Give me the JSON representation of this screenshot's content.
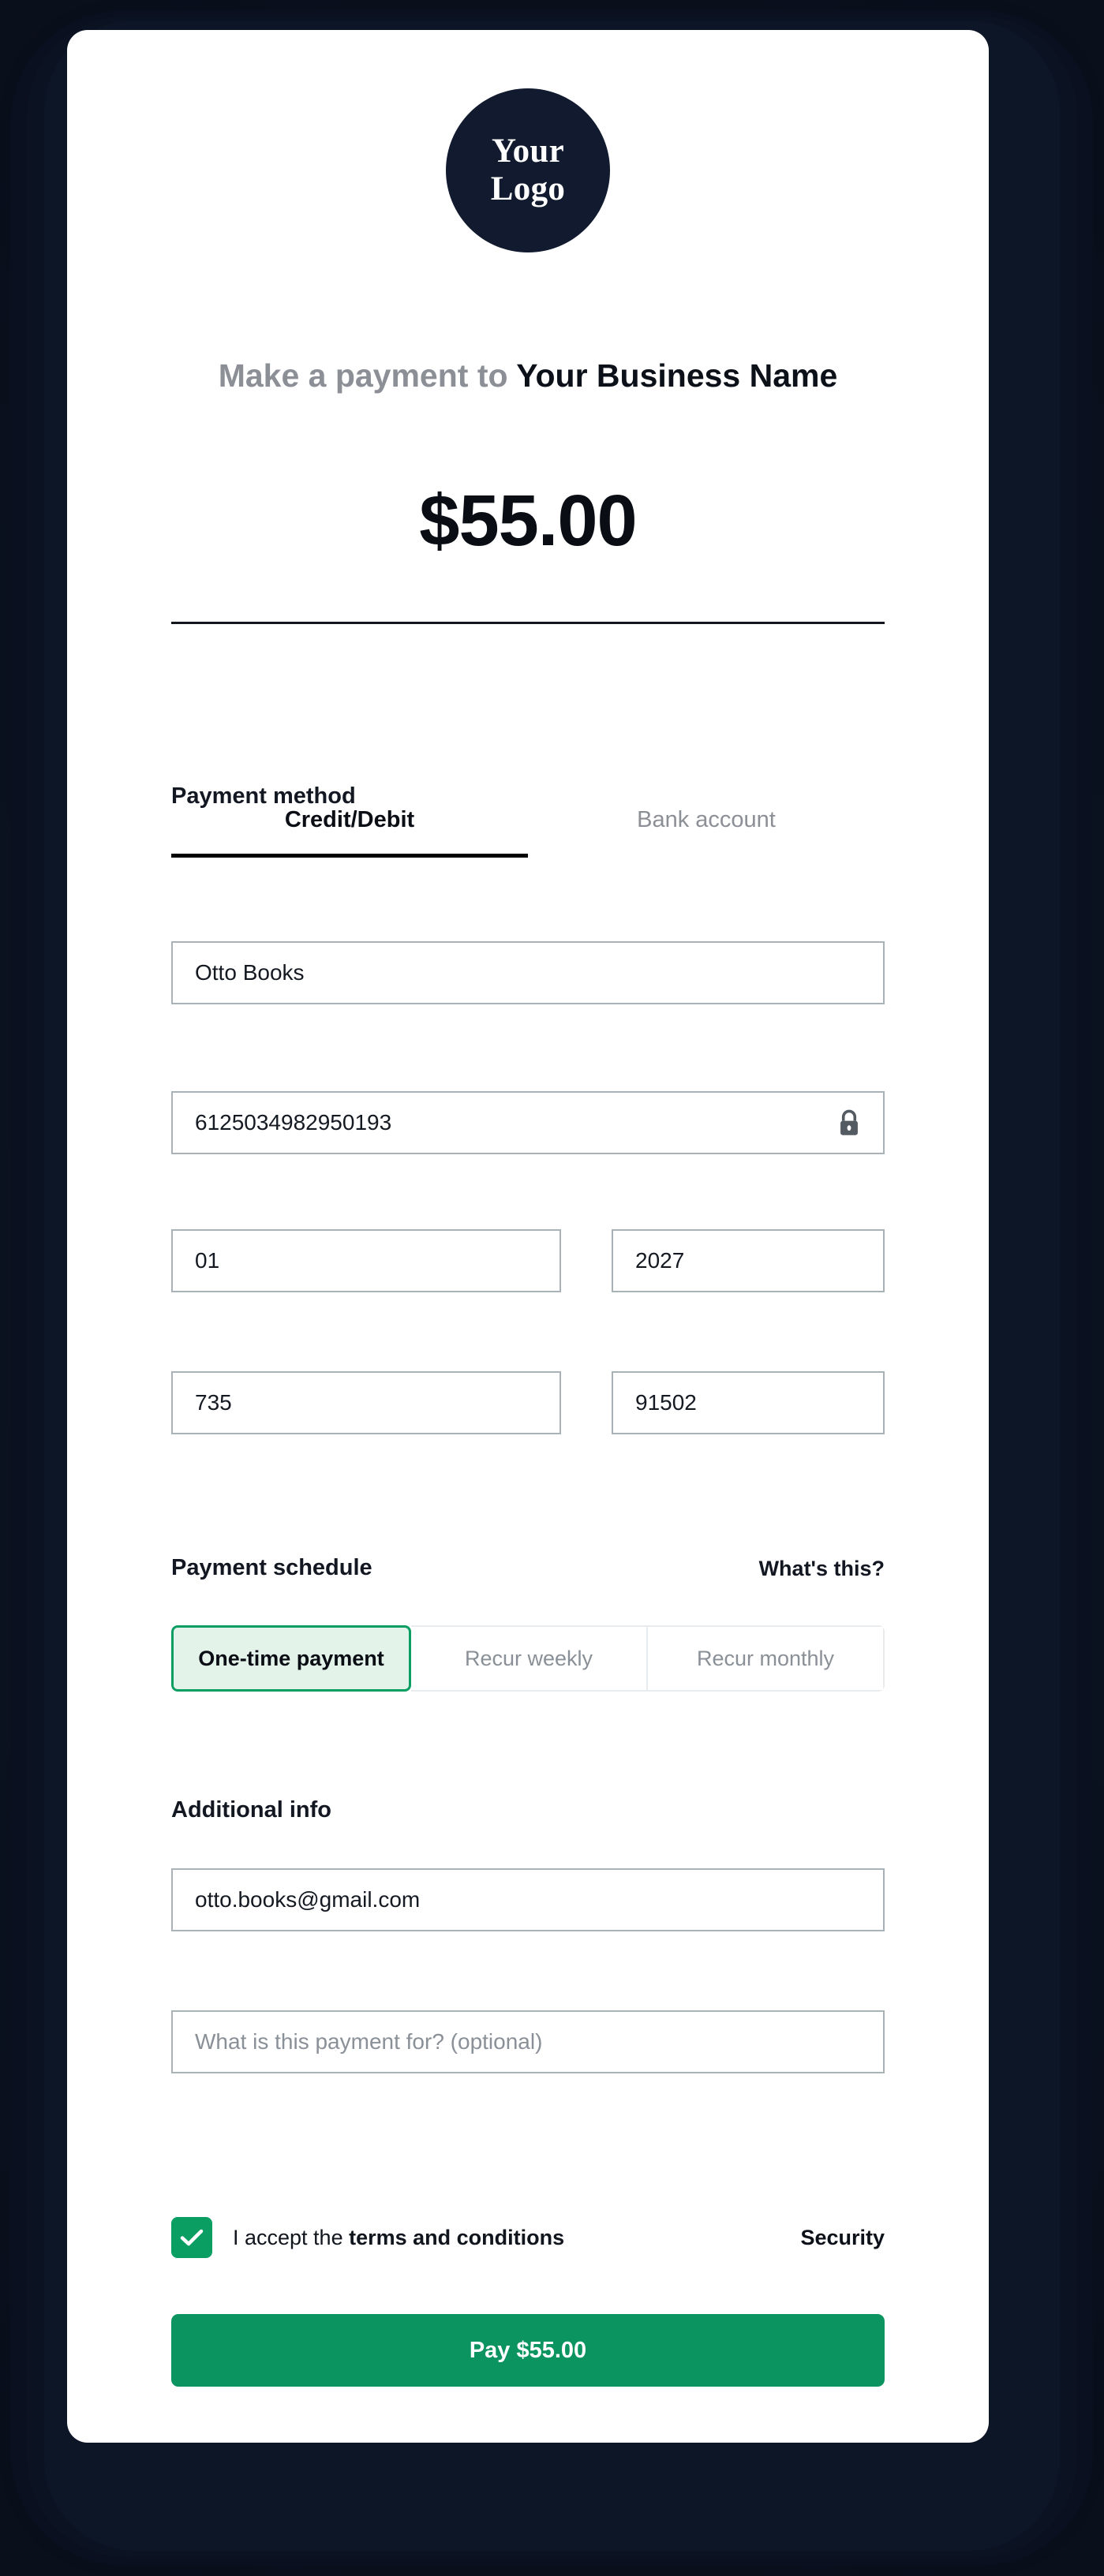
{
  "brand": {
    "logo_line_1": "Your",
    "logo_line_2": "Logo",
    "logo_bg_color": "#111a2e"
  },
  "header": {
    "prefix": "Make a payment to ",
    "business_name": "Your Business Name",
    "amount": "$55.00"
  },
  "payment_method": {
    "label": "Payment method",
    "tabs": [
      {
        "label": "Credit/Debit",
        "active": true
      },
      {
        "label": "Bank account",
        "active": false
      }
    ]
  },
  "card_form": {
    "name_on_card": "Otto Books",
    "card_number": "6125034982950193",
    "lock_icon": "lock-icon",
    "exp_month": "01",
    "exp_year": "2027",
    "cvv": "735",
    "zip": "91502"
  },
  "payment_schedule": {
    "label": "Payment schedule",
    "help_link": "What's this?",
    "options": [
      {
        "label": "One-time payment",
        "selected": true
      },
      {
        "label": "Recur weekly",
        "selected": false
      },
      {
        "label": "Recur monthly",
        "selected": false
      }
    ]
  },
  "additional_info": {
    "label": "Additional info",
    "email": "otto.books@gmail.com",
    "memo_placeholder": "What is this payment for? (optional)"
  },
  "terms": {
    "prefix": "I accept the ",
    "link_text": "terms and conditions",
    "checked": true,
    "security_label": "Security"
  },
  "footer": {
    "pay_button_label": "Pay $55.00"
  },
  "colors": {
    "accent_green": "#0b9460",
    "selected_green_border": "#0a9e63",
    "selected_green_bg": "#e4f3ea",
    "logo_navy": "#111a2e",
    "frame_navy": "#0a0f1c",
    "input_border": "#a9b2b7",
    "muted_text": "#8a9097"
  }
}
